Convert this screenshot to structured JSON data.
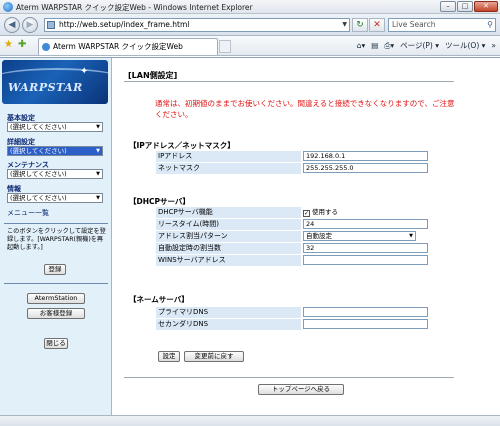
{
  "window": {
    "title": "Aterm WARPSTAR クイック設定Web - Windows Internet Explorer"
  },
  "address": {
    "url": "http://web.setup/index_frame.html"
  },
  "search": {
    "placeholder": "Live Search"
  },
  "tab": {
    "label": "Aterm WARPSTAR クイック設定Web"
  },
  "commands": {
    "page": "ページ(P) ▾",
    "tools": "ツール(O) ▾",
    "extend": "»"
  },
  "sidebar": {
    "logo_text": "WARPSTAR",
    "groups": [
      {
        "label": "基本設定",
        "value": "(選択してください)"
      },
      {
        "label": "詳細設定",
        "value": "(選択してください)"
      },
      {
        "label": "メンテナンス",
        "value": "(選択してください)"
      },
      {
        "label": "情報",
        "value": "(選択してください)"
      }
    ],
    "menu_list": "メニュー一覧",
    "note": "このボタンをクリックして設定を登録します。[WARPSTAR(親機)を再起動します。]",
    "register_button": "登録",
    "aterm_station_button": "AtermStation",
    "customer_register_button": "お客様登録",
    "close_button": "閉じる"
  },
  "main": {
    "title": "[LAN側設定]",
    "warning": "通常は、初期値のままでお使いください。間違えると接続できなくなりますので、ご注意ください。",
    "ip_section": {
      "title": "【IPアドレス／ネットマスク】",
      "rows": [
        {
          "label": "IPアドレス",
          "value": "192.168.0.1"
        },
        {
          "label": "ネットマスク",
          "value": "255.255.255.0"
        }
      ]
    },
    "dhcp_section": {
      "title": "【DHCPサーバ】",
      "rows": [
        {
          "label": "DHCPサーバ機能",
          "value": "使用する",
          "checked": true
        },
        {
          "label": "リースタイム(時間)",
          "value": "24"
        },
        {
          "label": "アドレス割当パターン",
          "value": "自動設定"
        },
        {
          "label": "自動設定時の割当数",
          "value": "32"
        },
        {
          "label": "WINSサーバアドレス",
          "value": ""
        }
      ]
    },
    "dns_section": {
      "title": "【ネームサーバ】",
      "rows": [
        {
          "label": "プライマリDNS",
          "value": ""
        },
        {
          "label": "セカンダリDNS",
          "value": ""
        }
      ]
    },
    "set_button": "設定",
    "revert_button": "変更前に戻す",
    "top_button": "トップページへ戻る"
  }
}
